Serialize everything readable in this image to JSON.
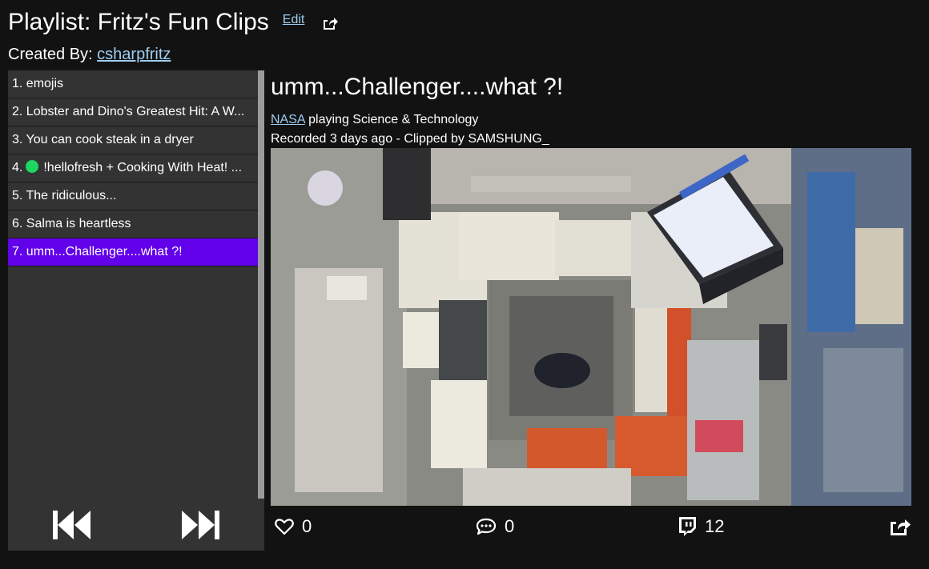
{
  "header": {
    "title": "Playlist: Fritz's Fun Clips",
    "edit_label": "Edit",
    "created_by_prefix": "Created By: ",
    "creator": "csharpfritz"
  },
  "playlist": {
    "items": [
      {
        "label": "1. emojis"
      },
      {
        "label": "2. Lobster and Dino's Greatest Hit: A W..."
      },
      {
        "label": "3. You can cook steak in a dryer"
      },
      {
        "number": "4.",
        "label": "!hellofresh + Cooking With Heat! ..."
      },
      {
        "label": "5. The ridiculous..."
      },
      {
        "label": "6. Salma is heartless"
      },
      {
        "label": "7. umm...Challenger....what ?!"
      }
    ],
    "active_index": 6
  },
  "clip": {
    "title": "umm...Challenger....what ?!",
    "channel": "NASA",
    "playing_text": " playing Science & Technology",
    "recorded_text": "Recorded 3 days ago - Clipped by SAMSHUNG_",
    "likes": "0",
    "comments": "0",
    "twitch_count": "12"
  },
  "colors": {
    "background": "#121212",
    "sidebar": "#333333",
    "active_item": "#6200ea",
    "link": "#9ecdf0",
    "live_dot": "#1ed760"
  },
  "icons": [
    "share-icon",
    "skip-previous-icon",
    "skip-next-icon",
    "heart-icon",
    "comment-icon",
    "twitch-icon"
  ]
}
